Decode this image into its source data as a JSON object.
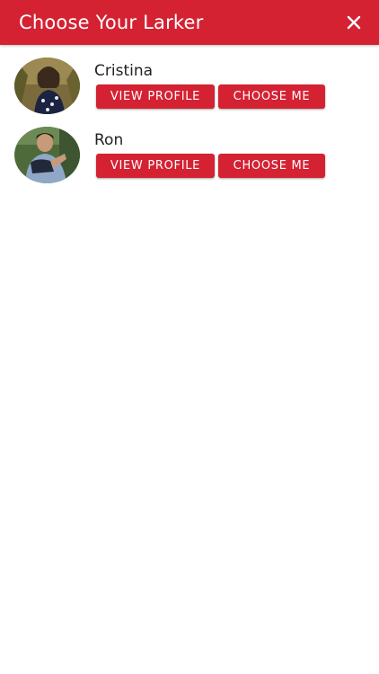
{
  "header": {
    "title": "Choose Your Larker",
    "close_icon": "close-icon"
  },
  "colors": {
    "accent": "#d42233",
    "text": "#222222",
    "background": "#ffffff"
  },
  "larkers": [
    {
      "name": "Cristina",
      "view_profile_label": "VIEW PROFILE",
      "choose_label": "CHOOSE ME"
    },
    {
      "name": "Ron",
      "view_profile_label": "VIEW PROFILE",
      "choose_label": "CHOOSE ME"
    }
  ]
}
